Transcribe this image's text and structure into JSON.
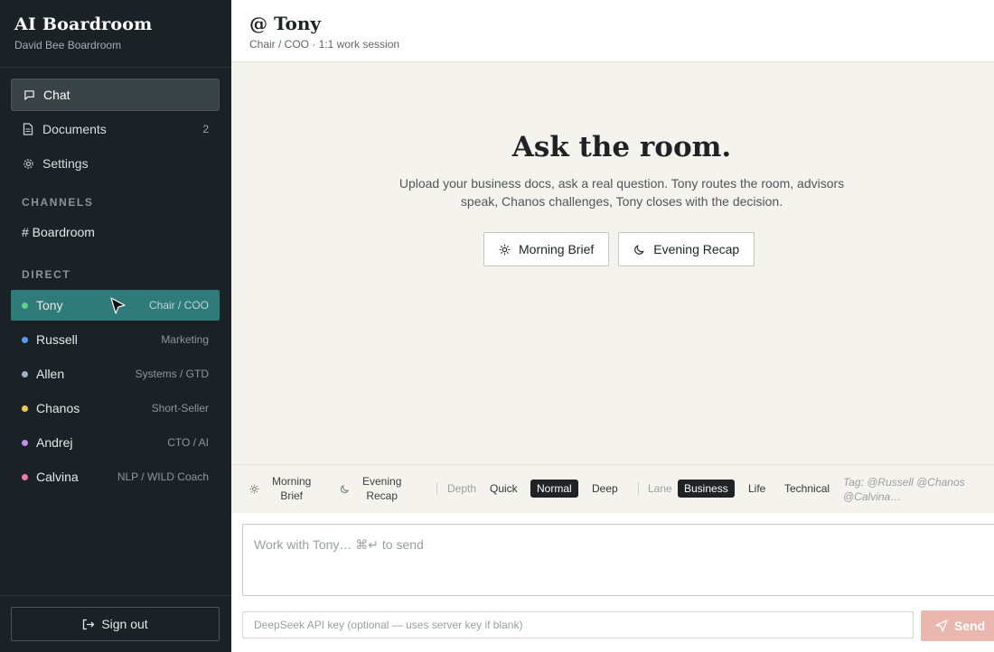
{
  "app": {
    "title": "AI Boardroom",
    "subtitle": "David Bee Boardroom"
  },
  "nav": [
    {
      "label": "Chat",
      "icon": "chat-bubble-icon",
      "active": true
    },
    {
      "label": "Documents",
      "icon": "document-icon",
      "count": "2"
    },
    {
      "label": "Settings",
      "icon": "gear-icon"
    }
  ],
  "channels": {
    "label": "CHANNELS",
    "items": [
      {
        "label": "# Boardroom"
      }
    ]
  },
  "direct": {
    "label": "DIRECT",
    "items": [
      {
        "name": "Tony",
        "role": "Chair / COO",
        "color": "#5fd08a",
        "active": true
      },
      {
        "name": "Russell",
        "role": "Marketing",
        "color": "#5a9cf0"
      },
      {
        "name": "Allen",
        "role": "Systems / GTD",
        "color": "#9fb3c8"
      },
      {
        "name": "Chanos",
        "role": "Short-Seller",
        "color": "#f2c94c"
      },
      {
        "name": "Andrej",
        "role": "CTO / AI",
        "color": "#c58af0"
      },
      {
        "name": "Calvina",
        "role": "NLP / WILD Coach",
        "color": "#f07ab0"
      }
    ]
  },
  "signout": {
    "label": "Sign out"
  },
  "header": {
    "title": "@ Tony",
    "subtitle": "Chair / COO · 1:1 work session"
  },
  "hero": {
    "title": "Ask the room.",
    "text": "Upload your business docs, ask a real question. Tony routes the room, advisors speak, Chanos challenges, Tony closes with the decision.",
    "buttons": [
      {
        "label": "Morning Brief",
        "icon": "sun-icon"
      },
      {
        "label": "Evening Recap",
        "icon": "moon-icon"
      }
    ]
  },
  "toolbar": {
    "morning_line1": "Morning",
    "morning_line2": "Brief",
    "evening_line1": "Evening",
    "evening_line2": "Recap",
    "depth_label": "Depth",
    "depth_options": [
      "Quick",
      "Normal",
      "Deep"
    ],
    "depth_selected": "Normal",
    "lane_label": "Lane",
    "lane_options": [
      "Business",
      "Life",
      "Technical"
    ],
    "lane_selected": "Business",
    "tag_hint": "Tag: @Russell @Chanos @Calvina…"
  },
  "composer": {
    "placeholder": "Work with Tony…  ⌘↵ to send",
    "api_placeholder": "DeepSeek API key (optional — uses server key if blank)",
    "send_label": "Send"
  }
}
